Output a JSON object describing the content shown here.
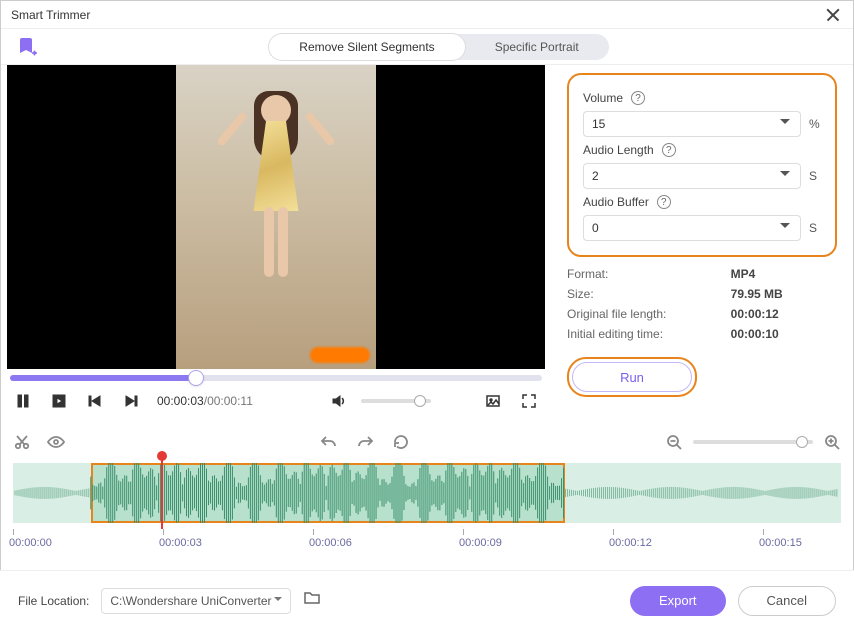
{
  "window": {
    "title": "Smart Trimmer"
  },
  "tabs": {
    "remove_silent": "Remove Silent Segments",
    "specific_portrait": "Specific Portrait"
  },
  "player": {
    "current": "00:00:03",
    "duration": "00:00:11"
  },
  "settings": {
    "volume": {
      "label": "Volume",
      "value": "15",
      "unit": "%"
    },
    "audio_length": {
      "label": "Audio Length",
      "value": "2",
      "unit": "S"
    },
    "audio_buffer": {
      "label": "Audio Buffer",
      "value": "0",
      "unit": "S"
    }
  },
  "meta": {
    "format_k": "Format:",
    "format_v": "MP4",
    "size_k": "Size:",
    "size_v": "79.95 MB",
    "orig_len_k": "Original file length:",
    "orig_len_v": "00:00:12",
    "init_edit_k": "Initial editing time:",
    "init_edit_v": "00:00:10"
  },
  "run": {
    "label": "Run"
  },
  "ruler": {
    "t0": "00:00:00",
    "t1": "00:00:03",
    "t2": "00:00:06",
    "t3": "00:00:09",
    "t4": "00:00:12",
    "t5": "00:00:15"
  },
  "footer": {
    "label": "File Location:",
    "path": "C:\\Wondershare UniConverter",
    "export": "Export",
    "cancel": "Cancel"
  }
}
